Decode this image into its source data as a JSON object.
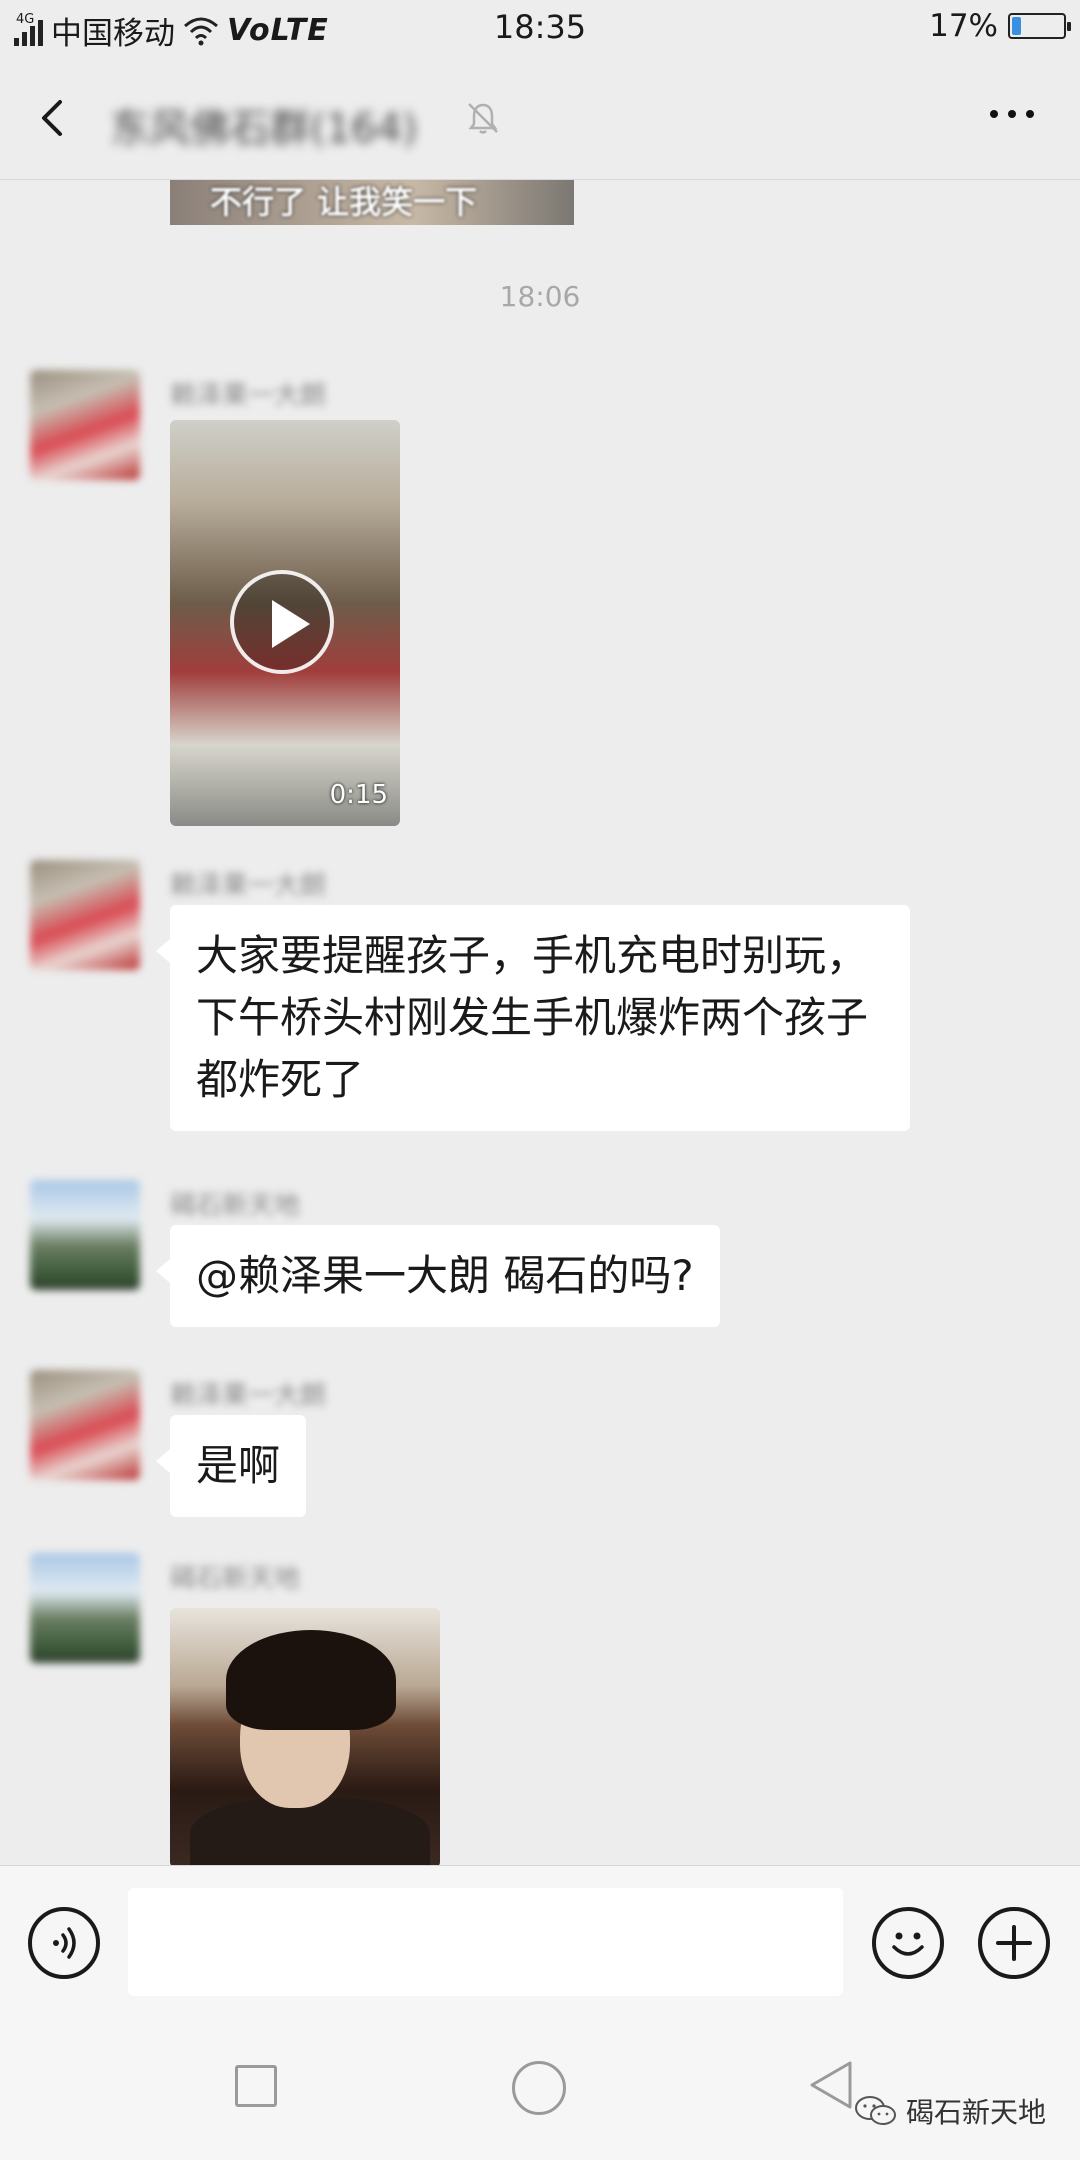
{
  "status_bar": {
    "network_tag": "4G",
    "carrier": "中国移动",
    "volte": "VoLTE",
    "time": "18:35",
    "battery_percent_text": "17%",
    "battery_level": 0.17,
    "accent_color": "#3a90e0"
  },
  "nav": {
    "title": "东风佛石群(164)",
    "muted": true,
    "back_icon": "chevron-left-icon",
    "more_icon": "more-dots-icon"
  },
  "chat": {
    "prev_video_caption": "不行了 让我笑一下",
    "timestamp": "18:06",
    "messages": [
      {
        "sender": "赖泽果一大朗",
        "type": "video",
        "duration": "0:15"
      },
      {
        "sender": "赖泽果一大朗",
        "type": "text",
        "text": "大家要提醒孩子，手机充电时别玩，下午桥头村刚发生手机爆炸两个孩子都炸死了"
      },
      {
        "sender": "碣石新天地",
        "type": "text",
        "text": "@赖泽果一大朗  碣石的吗?"
      },
      {
        "sender": "赖泽果一大朗",
        "type": "text",
        "text": "是啊"
      },
      {
        "sender": "碣石新天地",
        "type": "image"
      }
    ]
  },
  "input_bar": {
    "voice_icon": "voice-icon",
    "emoji_icon": "emoji-icon",
    "plus_icon": "plus-icon",
    "placeholder": ""
  },
  "system_nav": {
    "recent_icon": "recent-apps-icon",
    "home_icon": "home-icon",
    "back_icon": "back-triangle-icon"
  },
  "watermark": {
    "text": "碣石新天地"
  }
}
